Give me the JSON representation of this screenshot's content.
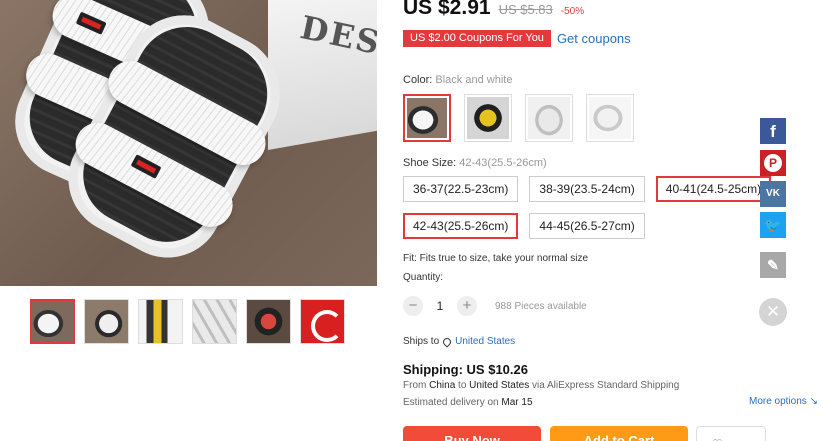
{
  "gallery": {
    "box_text": "DESI",
    "thumbnails": [
      {
        "alt": "white slipper top view",
        "active": true
      },
      {
        "alt": "white slipper angle"
      },
      {
        "alt": "slipper colors lineup"
      },
      {
        "alt": "white slippers pair"
      },
      {
        "alt": "black and red slipper"
      },
      {
        "alt": "brand logo"
      }
    ]
  },
  "price": {
    "current": "US $2.91",
    "original": "US $5.83",
    "discount": "-50%"
  },
  "coupon": {
    "badge": "US $2.00 Coupons For You",
    "link": "Get coupons"
  },
  "color": {
    "label": "Color:",
    "selected": "Black and white",
    "swatches": [
      "black-white",
      "black-yellow",
      "grey",
      "white"
    ]
  },
  "size": {
    "label": "Shoe Size:",
    "selected": "42-43(25.5-26cm)",
    "options": [
      "36-37(22.5-23cm)",
      "38-39(23.5-24cm)",
      "40-41(24.5-25cm)",
      "42-43(25.5-26cm)",
      "44-45(26.5-27cm)"
    ]
  },
  "fit": "Fit: Fits true to size, take your normal size",
  "quantity": {
    "label": "Quantity:",
    "minus": "−",
    "value": "1",
    "plus": "+",
    "available": "988 Pieces available"
  },
  "shipping": {
    "ships_to_label": "Ships to",
    "ships_to_country": "United States",
    "title": "Shipping: US $10.26",
    "from_prefix": "From",
    "from_country": "China",
    "to_word": "to",
    "to_country": "United States",
    "via": "via AliExpress Standard Shipping",
    "delivery_prefix": "Estimated delivery on",
    "delivery_date": "Mar 15",
    "more_options": "More options ↘"
  },
  "actions": {
    "buy_now": "Buy Now",
    "add_to_cart": "Add to Cart",
    "wishlist_icon": "♡"
  },
  "social": {
    "facebook": "f",
    "pinterest": "P",
    "vk": "VK",
    "twitter": "🐦",
    "edit": "✎",
    "close": "✕"
  },
  "colors": {
    "accent_red": "#e4393c",
    "link_blue": "#2a6ebb",
    "buy_now": "#f24b3a",
    "add_to_cart": "#ff9a17"
  }
}
